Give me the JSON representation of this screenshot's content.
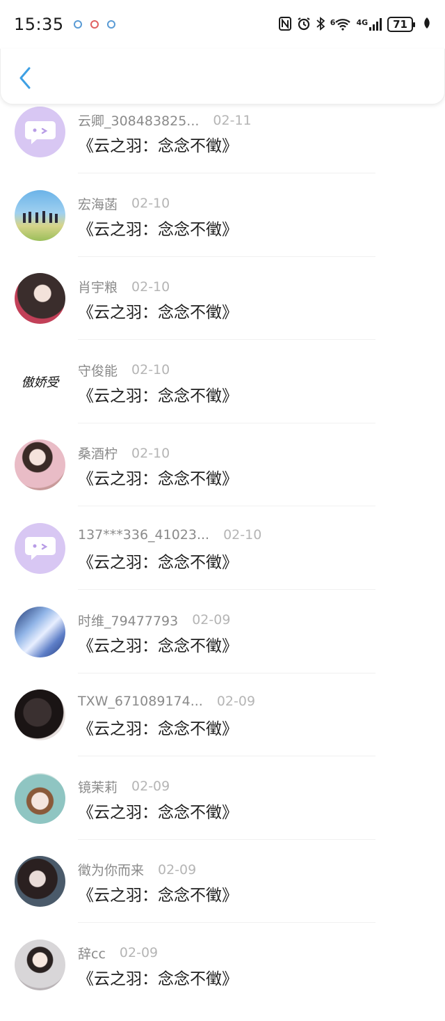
{
  "status_bar": {
    "time": "15:35",
    "network": "4G",
    "wifi_label": "6",
    "battery": "71"
  },
  "nav": {
    "back_icon": "chevron-left-icon"
  },
  "list": {
    "items": [
      {
        "name": "云卿_308483825...",
        "date": "02-11",
        "title": "《云之羽：念念不徵》",
        "avatar": "default-bubble"
      },
      {
        "name": "宏海菡",
        "date": "02-10",
        "title": "《云之羽：念念不徵》",
        "avatar": "photo"
      },
      {
        "name": "肖宇粮",
        "date": "02-10",
        "title": "《云之羽：念念不徵》",
        "avatar": "photo"
      },
      {
        "name": "守俊能",
        "date": "02-10",
        "title": "《云之羽：念念不徵》",
        "avatar": "calligraphy",
        "avatar_text": "傲娇受"
      },
      {
        "name": "桑酒柠",
        "date": "02-10",
        "title": "《云之羽：念念不徵》",
        "avatar": "photo"
      },
      {
        "name": "137***336_41023...",
        "date": "02-10",
        "title": "《云之羽：念念不徵》",
        "avatar": "default-bubble"
      },
      {
        "name": "时维_79477793",
        "date": "02-09",
        "title": "《云之羽：念念不徵》",
        "avatar": "photo"
      },
      {
        "name": "TXW_671089174...",
        "date": "02-09",
        "title": "《云之羽：念念不徵》",
        "avatar": "photo"
      },
      {
        "name": "镜茉莉",
        "date": "02-09",
        "title": "《云之羽：念念不徵》",
        "avatar": "photo"
      },
      {
        "name": "徵为你而来",
        "date": "02-09",
        "title": "《云之羽：念念不徵》",
        "avatar": "photo"
      },
      {
        "name": "辞cc",
        "date": "02-09",
        "title": "《云之羽：念念不徵》",
        "avatar": "photo"
      }
    ]
  },
  "colors": {
    "accent": "#3ea0e4",
    "bubble_avatar": "#d8c7f3",
    "name_text": "#8a8a8a",
    "date_text": "#b5b5b5"
  }
}
